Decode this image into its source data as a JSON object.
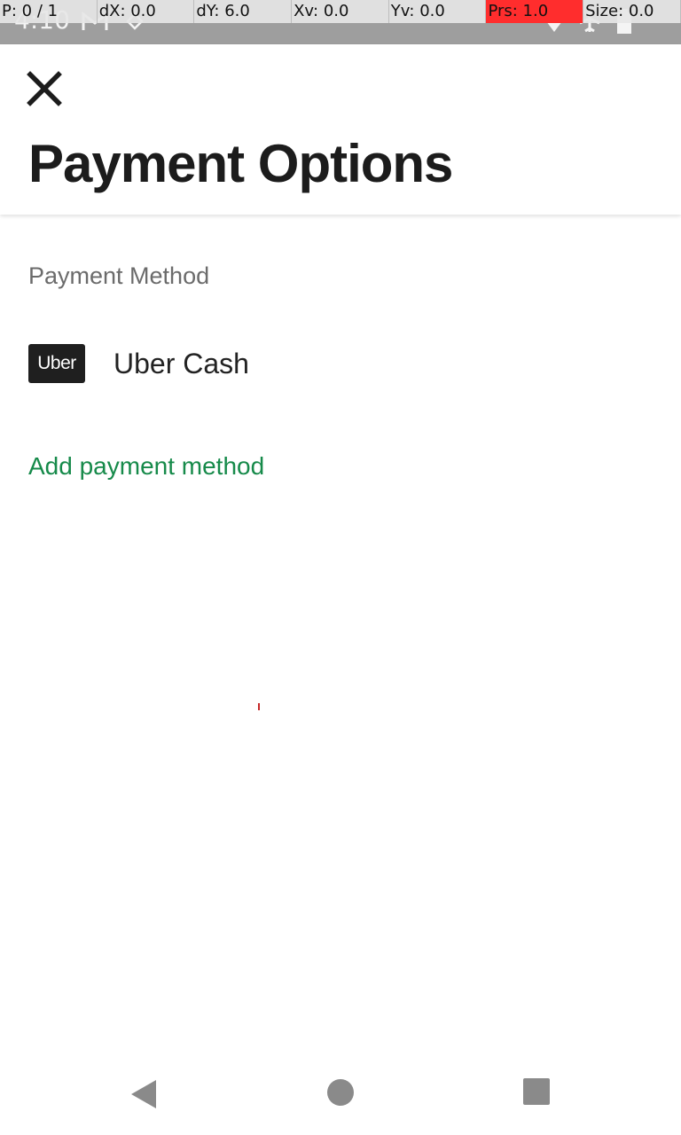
{
  "status_bar": {
    "time": "4:10",
    "icons": [
      "gmail-icon",
      "location-icon",
      "wifi-icon",
      "airplane-icon",
      "battery-icon"
    ]
  },
  "debug_overlay": {
    "pointer": "P: 0 / 1",
    "dx": "dX: 0.0",
    "dy": "dY: 6.0",
    "xv": "Xv: 0.0",
    "yv": "Yv: 0.0",
    "prs": "Prs: 1.0",
    "size": "Size: 0.0",
    "alert_color": "#ff2d2d"
  },
  "header": {
    "close_icon": "close-icon",
    "title": "Payment Options"
  },
  "payment": {
    "section_label": "Payment Method",
    "methods": [
      {
        "logo_text": "Uber",
        "name": "Uber Cash"
      }
    ],
    "add_label": "Add payment method"
  },
  "colors": {
    "link": "#168a4a",
    "title": "#1c1c1c",
    "logo_bg": "#1f1f1f"
  },
  "nav_bar": {
    "buttons": [
      "back-icon",
      "home-icon",
      "recents-icon"
    ]
  }
}
